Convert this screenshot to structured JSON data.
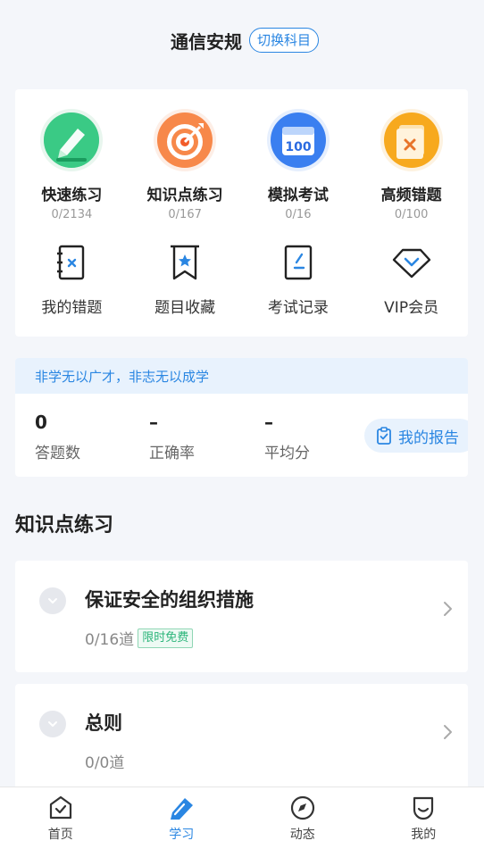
{
  "header": {
    "title": "通信安规",
    "switch_label": "切换科目"
  },
  "practice_modes": [
    {
      "label": "快速练习",
      "progress": "0/2134",
      "icon": "pencil-icon"
    },
    {
      "label": "知识点练习",
      "progress": "0/167",
      "icon": "target-icon"
    },
    {
      "label": "模拟考试",
      "progress": "0/16",
      "icon": "calendar-100-icon"
    },
    {
      "label": "高频错题",
      "progress": "0/100",
      "icon": "wrong-paper-icon"
    }
  ],
  "tools": [
    {
      "label": "我的错题",
      "icon": "wrong-book-icon"
    },
    {
      "label": "题目收藏",
      "icon": "bookmark-star-icon"
    },
    {
      "label": "考试记录",
      "icon": "exam-record-icon"
    },
    {
      "label": "VIP会员",
      "icon": "diamond-icon"
    }
  ],
  "stats": {
    "motto": "非学无以广才，非志无以成学",
    "answered_value": "0",
    "answered_label": "答题数",
    "accuracy_value": "–",
    "accuracy_label": "正确率",
    "avg_value": "–",
    "avg_label": "平均分",
    "report_label": "我的报告"
  },
  "section": {
    "title": "知识点练习"
  },
  "knowledge_points": [
    {
      "title": "保证安全的组织措施",
      "count": "0/16道",
      "badge": "限时免费"
    },
    {
      "title": "总则",
      "count": "0/0道"
    }
  ],
  "tabbar": [
    {
      "label": "首页",
      "icon": "home-icon"
    },
    {
      "label": "学习",
      "icon": "study-pencil-icon",
      "active": true
    },
    {
      "label": "动态",
      "icon": "compass-icon"
    },
    {
      "label": "我的",
      "icon": "profile-icon"
    }
  ],
  "colors": {
    "accent": "#2a86e2",
    "free_badge": "#2cb57a",
    "background": "#f4f6fa"
  }
}
